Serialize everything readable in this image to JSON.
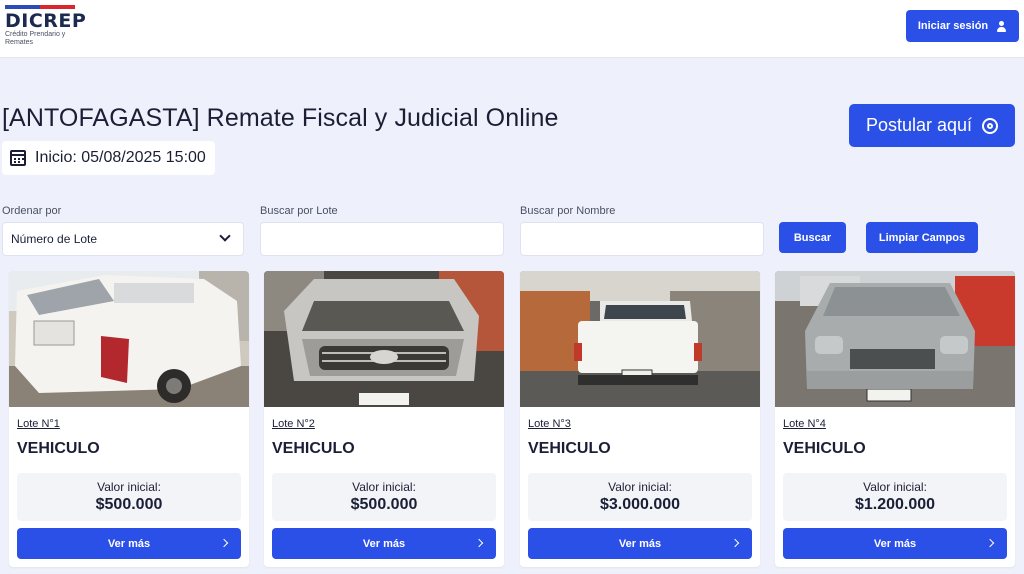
{
  "header": {
    "logo_name": "DICREP",
    "logo_sub": "Crédito Prendario y Remates",
    "login_label": "Iniciar sesión",
    "brand_colors": {
      "blue": "#2a50e8",
      "flag_blue": "#2b4bb8",
      "flag_red": "#d8262c"
    }
  },
  "auction": {
    "title": "[ANTOFAGASTA] Remate Fiscal y Judicial Online",
    "start_label": "Inicio: 05/08/2025 15:00",
    "apply_label": "Postular aquí"
  },
  "filters": {
    "sort_label": "Ordenar por",
    "sort_value": "Número de Lote",
    "lot_label": "Buscar por Lote",
    "lot_value": "",
    "name_label": "Buscar por Nombre",
    "name_value": "",
    "search_button": "Buscar",
    "clear_button": "Limpiar Campos"
  },
  "lots": [
    {
      "lot": "Lote N°1",
      "name": "VEHICULO",
      "price_label": "Valor inicial:",
      "price": "$500.000",
      "button": "Ver más"
    },
    {
      "lot": "Lote N°2",
      "name": "VEHICULO",
      "price_label": "Valor inicial:",
      "price": "$500.000",
      "button": "Ver más"
    },
    {
      "lot": "Lote N°3",
      "name": "VEHICULO",
      "price_label": "Valor inicial:",
      "price": "$3.000.000",
      "button": "Ver más"
    },
    {
      "lot": "Lote N°4",
      "name": "VEHICULO",
      "price_label": "Valor inicial:",
      "price": "$1.200.000",
      "button": "Ver más"
    }
  ]
}
